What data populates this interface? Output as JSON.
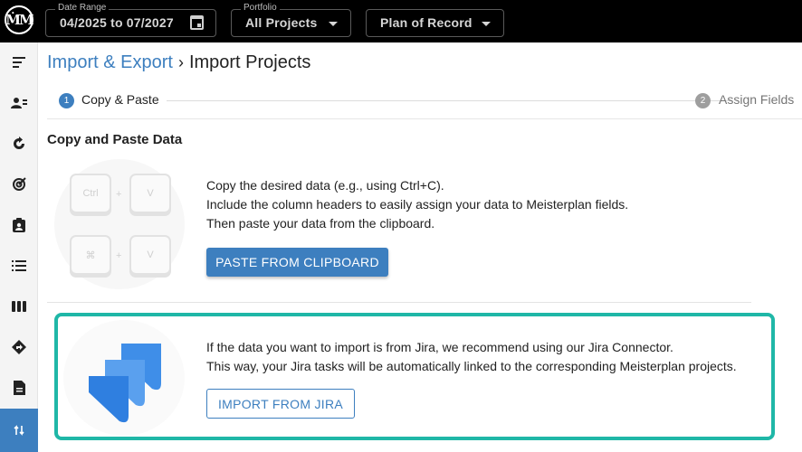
{
  "app": {
    "logo_text": "ṀM"
  },
  "topbar": {
    "date_range": {
      "legend": "Date Range",
      "value": "04/2025 to 07/2027"
    },
    "portfolio": {
      "legend": "Portfolio",
      "value": "All Projects"
    },
    "scenario": {
      "value": "Plan of Record"
    }
  },
  "sidebar": {
    "items": [
      {
        "icon": "menu-icon"
      },
      {
        "icon": "people-icon"
      },
      {
        "icon": "refresh-icon"
      },
      {
        "icon": "target-icon"
      },
      {
        "icon": "badge-icon"
      },
      {
        "icon": "list-icon"
      },
      {
        "icon": "columns-icon"
      },
      {
        "icon": "diamond-arrow-icon"
      },
      {
        "icon": "document-icon"
      },
      {
        "icon": "import-export-icon",
        "active": true
      }
    ]
  },
  "breadcrumb": {
    "parent": "Import & Export",
    "separator": "›",
    "current": "Import Projects"
  },
  "stepper": {
    "steps": [
      {
        "number": "1",
        "label": "Copy & Paste",
        "active": true
      },
      {
        "number": "2",
        "label": "Assign Fields",
        "active": false
      }
    ]
  },
  "section": {
    "title": "Copy and Paste Data",
    "keys": [
      "Ctrl",
      "+",
      "V",
      "⌘",
      "+",
      "V"
    ],
    "lines": [
      "Copy the desired data (e.g., using Ctrl+C).",
      "Include the column headers to easily assign your data to Meisterplan fields.",
      "Then paste your data from the clipboard."
    ],
    "paste_button": "PASTE FROM CLIPBOARD"
  },
  "jira": {
    "lines": [
      "If the data you want to import is from Jira, we recommend using our Jira Connector.",
      "This way, your Jira tasks will be automatically linked to the corresponding Meisterplan projects."
    ],
    "import_button": "IMPORT FROM JIRA",
    "border_color": "#1fb7a7"
  },
  "colors": {
    "accent": "#3d7fbf",
    "topbar": "#000000",
    "jira_border": "#1fb7a7"
  }
}
